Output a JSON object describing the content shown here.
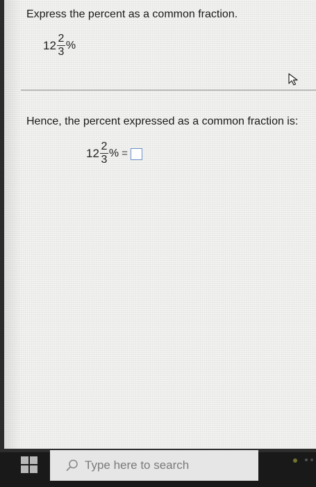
{
  "question": {
    "prompt": "Express the percent as a common fraction.",
    "mixed_number": {
      "whole": "12",
      "numerator": "2",
      "denominator": "3",
      "percent_sign": "%"
    }
  },
  "answer_section": {
    "lead_text": "Hence, the percent expressed as a common fraction is:",
    "mixed_number": {
      "whole": "12",
      "numerator": "2",
      "denominator": "3",
      "percent_sign": "%"
    },
    "equals": "=",
    "answer_value": ""
  },
  "taskbar": {
    "search_placeholder": "Type here to search"
  },
  "colors": {
    "answer_box_border": "#6b8fc9",
    "taskbar_bg": "#191919",
    "search_bg": "#e6e6e6"
  }
}
